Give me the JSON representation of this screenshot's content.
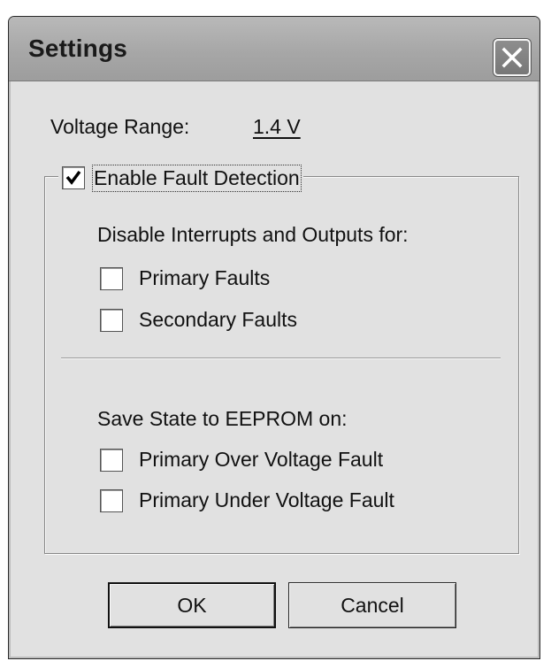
{
  "window": {
    "title": "Settings",
    "close_icon": "close-x-icon"
  },
  "voltage": {
    "label": "Voltage Range:",
    "value": "1.4 V"
  },
  "fault_detection": {
    "label": "Enable Fault Detection",
    "checked": true,
    "disable_header": "Disable Interrupts and Outputs for:",
    "disable_options": [
      {
        "label": "Primary Faults",
        "checked": false
      },
      {
        "label": "Secondary Faults",
        "checked": false
      }
    ],
    "save_header": "Save State to EEPROM on:",
    "save_options": [
      {
        "label": "Primary Over Voltage Fault",
        "checked": false
      },
      {
        "label": "Primary Under Voltage Fault",
        "checked": false
      }
    ]
  },
  "buttons": {
    "ok": "OK",
    "cancel": "Cancel"
  }
}
